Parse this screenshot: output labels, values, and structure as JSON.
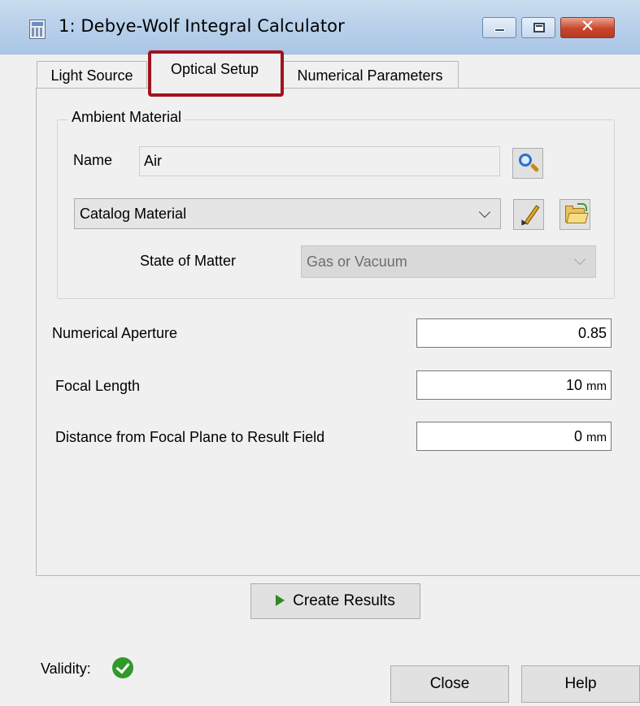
{
  "window": {
    "title": "1: Debye-Wolf Integral Calculator",
    "close_glyph": "✕"
  },
  "tabs": [
    {
      "label": "Light Source",
      "selected": false
    },
    {
      "label": "Optical Setup",
      "selected": true
    },
    {
      "label": "Numerical Parameters",
      "selected": false
    }
  ],
  "ambient_material": {
    "group_label": "Ambient Material",
    "name_label": "Name",
    "name_value": "Air",
    "material_type": "Catalog Material",
    "state_label": "State of Matter",
    "state_value": "Gas or Vacuum"
  },
  "fields": {
    "numerical_aperture": {
      "label": "Numerical Aperture",
      "value": "0.85"
    },
    "focal_length": {
      "label": "Focal Length",
      "value": "10",
      "unit": "mm"
    },
    "distance": {
      "label": "Distance from Focal Plane to Result Field",
      "value": "0",
      "unit": "mm"
    }
  },
  "actions": {
    "create_results": "Create Results",
    "close": "Close",
    "help": "Help"
  },
  "validity": {
    "label": "Validity:",
    "status_color": "#2f9a2a"
  },
  "colors": {
    "highlight": "#a0141d"
  }
}
